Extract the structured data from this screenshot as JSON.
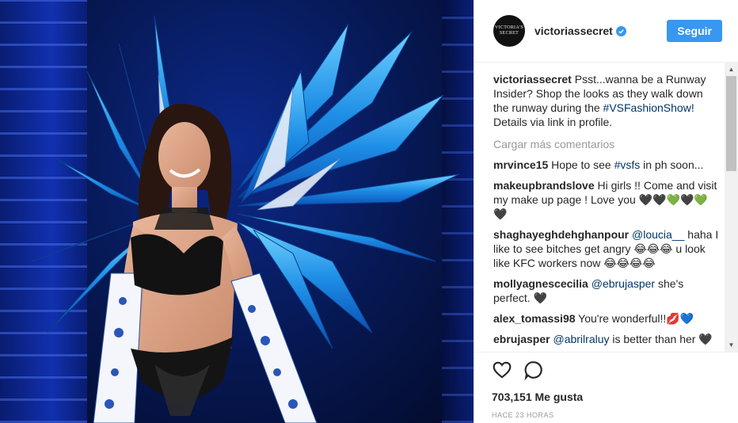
{
  "post": {
    "username": "victoriassecret",
    "avatar_text": "VICTORIA'S SECRET",
    "follow_label": "Seguir",
    "verified_icon": "verified-badge-icon",
    "caption": {
      "user": "victoriassecret",
      "text_before": "Psst...wanna be a Runway Insider? Shop the looks as they walk down the runway during the ",
      "hashtag": "#VSFashionShow!",
      "text_after": " Details via link in profile."
    },
    "load_more": "Cargar más comentarios",
    "comments": [
      {
        "user": "mrvince15",
        "before": "Hope to see ",
        "link": "#vsfs",
        "after": " in ph soon..."
      },
      {
        "user": "makeupbrandslove",
        "before": "Hi girls !! Come and visit my make up page ! Love you 🖤🖤💚🖤💚🖤",
        "link": "",
        "after": ""
      },
      {
        "user": "shaghayeghdehghanpour",
        "before": "",
        "link": "@loucia__",
        "after": " haha I like to see bitches get angry 😂😂😂 u look like KFC workers now 😂😂😂😂"
      },
      {
        "user": "mollyagnescecilia",
        "before": "",
        "link": "@ebrujasper",
        "after": " she's perfect. 🖤"
      },
      {
        "user": "alex_tomassi98",
        "before": "You're wonderful!!💋💙",
        "link": "",
        "after": ""
      },
      {
        "user": "ebrujasper",
        "before": "",
        "link": "@abrilraluy",
        "after": " is better than her 🖤 □□□□□□"
      }
    ],
    "likes": "703,151 Me gusta",
    "timestamp": "HACE 23 HORAS",
    "icons": {
      "like": "heart-icon",
      "comment": "comment-bubble-icon"
    },
    "colors": {
      "accent": "#3897f0",
      "link": "#003569",
      "muted": "#999999"
    }
  }
}
